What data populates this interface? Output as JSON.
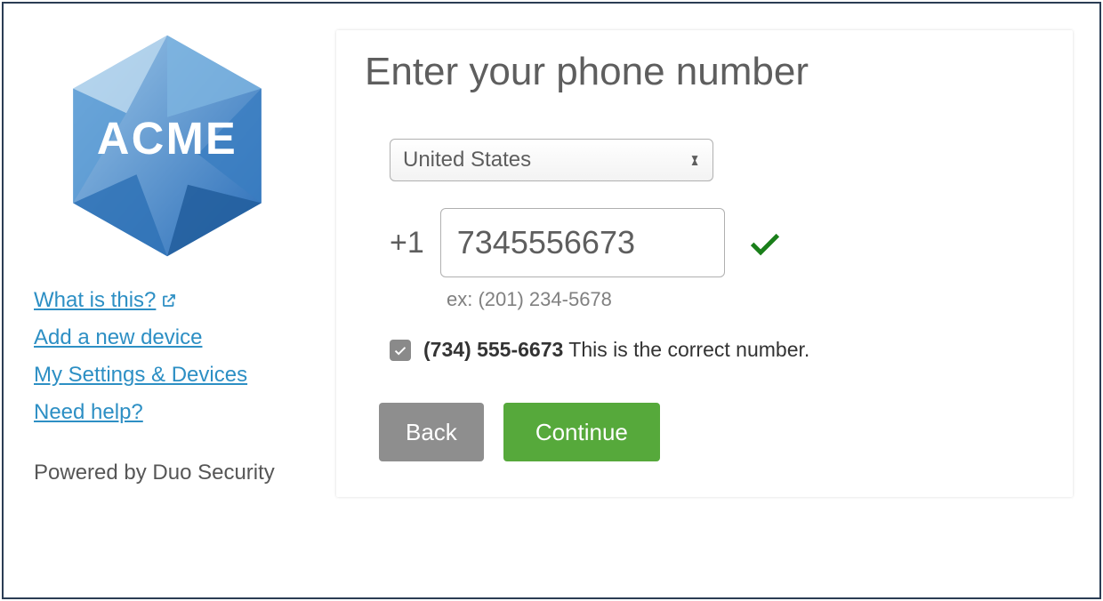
{
  "sidebar": {
    "logo_text": "ACME",
    "links": {
      "what_is_this": "What is this?",
      "add_device": "Add a new device",
      "settings": "My Settings & Devices",
      "need_help": "Need help?"
    },
    "powered_by": "Powered by Duo Security"
  },
  "main": {
    "title": "Enter your phone number",
    "country": "United States",
    "dial_code": "+1",
    "phone_value": "7345556673",
    "example": "ex: (201) 234-5678",
    "confirm_number": "(734) 555-6673",
    "confirm_text": " This is the correct number.",
    "back_label": "Back",
    "continue_label": "Continue"
  }
}
